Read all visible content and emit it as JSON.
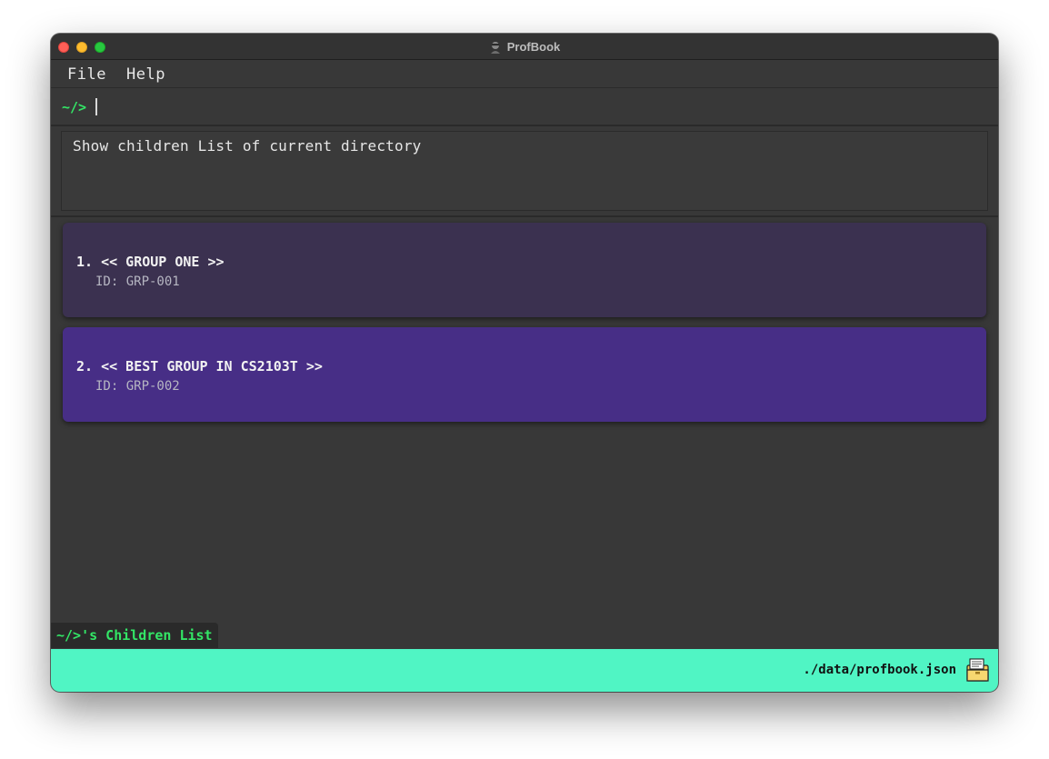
{
  "window": {
    "title": "ProfBook"
  },
  "menu": {
    "file": "File",
    "help": "Help"
  },
  "command_box": {
    "prompt": "~/>",
    "value": "",
    "placeholder": ""
  },
  "result_display": {
    "text": "Show children List of current directory"
  },
  "children_list": [
    {
      "index": "1.",
      "name": "<< GROUP ONE >>",
      "id": "ID: GRP-001",
      "color": "#3b3150"
    },
    {
      "index": "2.",
      "name": "<< BEST GROUP IN CS2103T >>",
      "id": "ID: GRP-002",
      "color": "#472e86"
    }
  ],
  "panel_label": "~/>'s Children List",
  "status_bar": {
    "file_path": "./data/profbook.json",
    "background": "#50f5c4"
  },
  "colors": {
    "prompt_green": "#33e666",
    "window_bg": "#383838"
  },
  "icons": {
    "app": "profbook-app-icon",
    "status": "folder-icon"
  }
}
